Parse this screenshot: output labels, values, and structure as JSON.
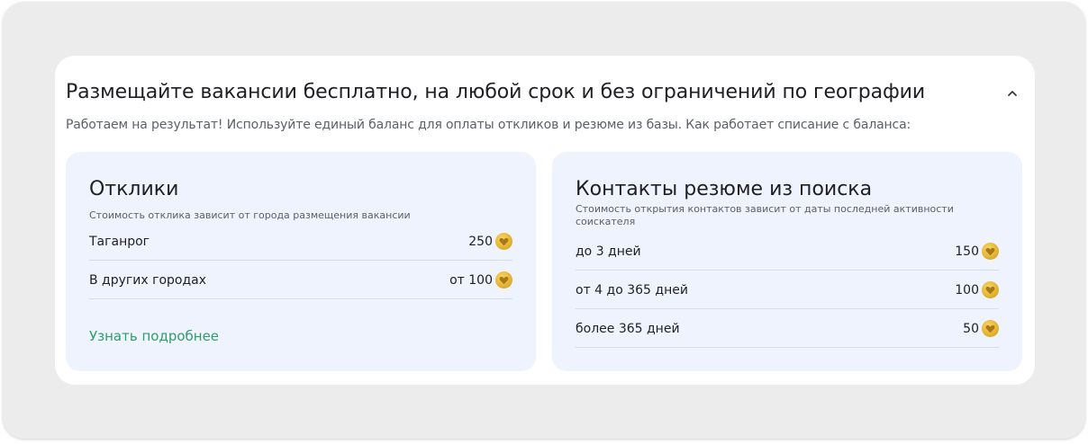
{
  "header": {
    "title": "Размещайте вакансии бесплатно, на любой срок и без ограничений по географии",
    "subtitle": "Работаем на результат! Используйте единый баланс для оплаты откликов и резюме из базы. Как работает списание с баланса:"
  },
  "responses": {
    "title": "Отклики",
    "description": "Стоимость отклика зависит от города размещения вакансии",
    "rows": [
      {
        "label": "Таганрог",
        "price": "250"
      },
      {
        "label": "В других городах",
        "price": "от 100"
      }
    ],
    "more_link": "Узнать подробнее"
  },
  "contacts": {
    "title": "Контакты резюме из поиска",
    "description": "Стоимость открытия контактов зависит от даты последней активности соискателя",
    "rows": [
      {
        "label": "до 3 дней",
        "price": "150"
      },
      {
        "label": "от 4 до 365 дней",
        "price": "100"
      },
      {
        "label": "более 365 дней",
        "price": "50"
      }
    ]
  },
  "icons": {
    "collapse": "chevron-up-icon",
    "coin": "heart-coin-icon"
  },
  "colors": {
    "accent_link": "#2f9e67",
    "card_background": "#eef3fd",
    "coin": "#e3b22e"
  }
}
